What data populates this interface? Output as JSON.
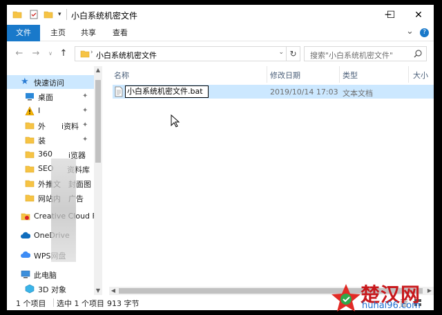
{
  "window": {
    "title": "小白系统机密文件",
    "minimize_glyph": "─",
    "maximize_glyph": "☐",
    "close_glyph": "✕"
  },
  "ribbon": {
    "tabs": [
      {
        "label": "文件"
      },
      {
        "label": "主页"
      },
      {
        "label": "共享"
      },
      {
        "label": "查看"
      }
    ],
    "collapse_glyph": "⌄",
    "help_glyph": "?"
  },
  "address": {
    "path": "小白系统机密文件",
    "search_placeholder": "搜索\"小白系统机密文件\""
  },
  "navigation": {
    "items": [
      {
        "label": "快速访问",
        "icon": "star-icon",
        "pinned": false
      },
      {
        "label": "桌面",
        "icon": "desktop-icon",
        "pinned": true
      },
      {
        "label": "I",
        "icon": "warning-icon",
        "pinned": true
      },
      {
        "label": "外",
        "label2": "i资料",
        "icon": "folder-icon",
        "pinned": true
      },
      {
        "label": "装",
        "icon": "folder-icon",
        "pinned": true
      },
      {
        "label": "360",
        "label2": "i览器",
        "icon": "folder-icon",
        "pinned": false
      },
      {
        "label": "SEO",
        "label2": "资料库",
        "icon": "folder-icon",
        "pinned": false
      },
      {
        "label": "外推文",
        "label2": "封面图",
        "icon": "folder-icon",
        "pinned": false
      },
      {
        "label": "网站内",
        "label2": "广告",
        "icon": "folder-icon",
        "pinned": false
      },
      {
        "label": "Creative Cloud F",
        "icon": "creative-cloud-icon",
        "pinned": false
      },
      {
        "label": "OneDrive",
        "icon": "onedrive-icon",
        "pinned": false
      },
      {
        "label": "WPS网盘",
        "icon": "wps-cloud-icon",
        "pinned": false
      },
      {
        "label": "此电脑",
        "icon": "computer-icon",
        "pinned": false
      },
      {
        "label": "3D 对象",
        "icon": "3d-objects-icon",
        "pinned": false
      }
    ]
  },
  "columns": {
    "name": "名称",
    "modified": "修改日期",
    "type": "类型",
    "size": "大小"
  },
  "files": [
    {
      "name": "小白系统机密文件.bat",
      "modified": "2019/10/14 17:03",
      "type": "文本文档"
    }
  ],
  "status": {
    "count": "1 个项目",
    "selection": "选中 1 个项目",
    "size": "913 字节"
  },
  "watermark": {
    "text": "楚汉网",
    "url": "huhai96.com"
  },
  "colors": {
    "accent": "#1979ca",
    "selection": "#cce8ff",
    "folder": "#f6c344"
  }
}
